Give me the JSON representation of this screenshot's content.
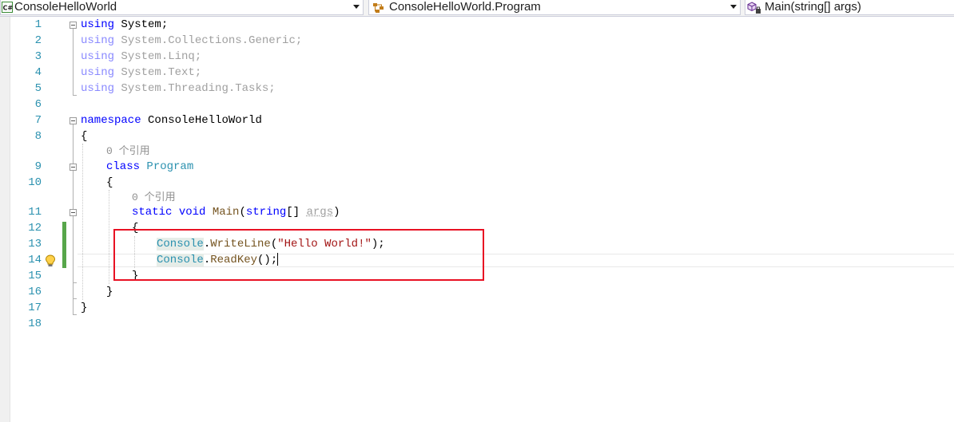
{
  "nav": {
    "project": "ConsoleHelloWorld",
    "type": "ConsoleHelloWorld.Program",
    "member": "Main(string[] args)",
    "project_icon": "csharp-project-icon",
    "type_icon": "class-icon",
    "member_icon": "method-icon"
  },
  "line_numbers": [
    "1",
    "2",
    "3",
    "4",
    "5",
    "6",
    "7",
    "8",
    "9",
    "10",
    "11",
    "12",
    "13",
    "14",
    "15",
    "16",
    "17",
    "18"
  ],
  "code": {
    "using_kw": "using",
    "ns1": "System;",
    "ns2": "System.Collections.Generic;",
    "ns3": "System.Linq;",
    "ns4": "System.Text;",
    "ns5": "System.Threading.Tasks;",
    "namespace_kw": "namespace",
    "namespace_name": "ConsoleHelloWorld",
    "open_brace": "{",
    "close_brace": "}",
    "refs_class": "0 个引用",
    "class_kw": "class",
    "class_name": "Program",
    "refs_method": "0 个引用",
    "static_kw": "static",
    "void_kw": "void",
    "method_name": "Main",
    "paren_open": "(",
    "string_kw": "string",
    "array_brackets": "[] ",
    "param_name": "args",
    "paren_close": ")",
    "console_type": "Console",
    "dot": ".",
    "writeline": "WriteLine",
    "string_literal": "\"Hello World!\"",
    "call_end": ");",
    "readkey": "ReadKey",
    "empty_call": "();"
  },
  "colors": {
    "keyword": "#0000ff",
    "type": "#2b91af",
    "string": "#a31515",
    "highlight_box": "#e81123",
    "change_bar": "#57a64a"
  }
}
